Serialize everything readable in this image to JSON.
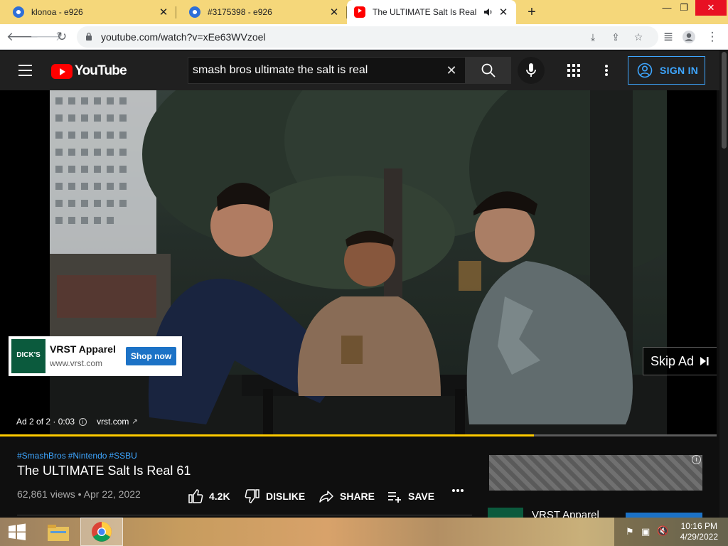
{
  "browser": {
    "tabs": [
      {
        "title": "klonoa - e926",
        "favicon": "e926-icon"
      },
      {
        "title": "#3175398 - e926",
        "favicon": "e926-icon"
      },
      {
        "title": "The ULTIMATE Salt Is Real 61",
        "favicon": "youtube-icon",
        "active": true
      }
    ],
    "url": "youtube.com/watch?v=xEe63WVzoel"
  },
  "youtube": {
    "logo_text": "YouTube",
    "search_query": "smash bros ultimate the salt is real",
    "sign_in_label": "SIGN IN"
  },
  "ad": {
    "advertiser": "VRST Apparel",
    "advertiser_site": "www.vrst.com",
    "brand_badge": "DICK'S",
    "cta_label": "Shop now",
    "skip_label": "Skip Ad",
    "ad_counter": "Ad 2 of 2 · 0:03",
    "ad_domain": "vrst.com",
    "progress_fraction": 0.745
  },
  "video": {
    "hashtags": [
      "#SmashBros",
      "#Nintendo",
      "#SSBU"
    ],
    "title": "The ULTIMATE Salt Is Real 61",
    "views": "62,861 views",
    "date": "Apr 22, 2022",
    "likes": "4.2K",
    "dislike_label": "DISLIKE",
    "share_label": "SHARE",
    "save_label": "SAVE"
  },
  "side_ad": {
    "title": "VRST Apparel"
  },
  "taskbar": {
    "time": "10:16 PM",
    "date": "4/29/2022"
  },
  "colors": {
    "accent_blue": "#3ea6ff",
    "youtube_red": "#ff0000",
    "progress_yellow": "#ffcc00",
    "tabstrip": "#f5d77a"
  }
}
